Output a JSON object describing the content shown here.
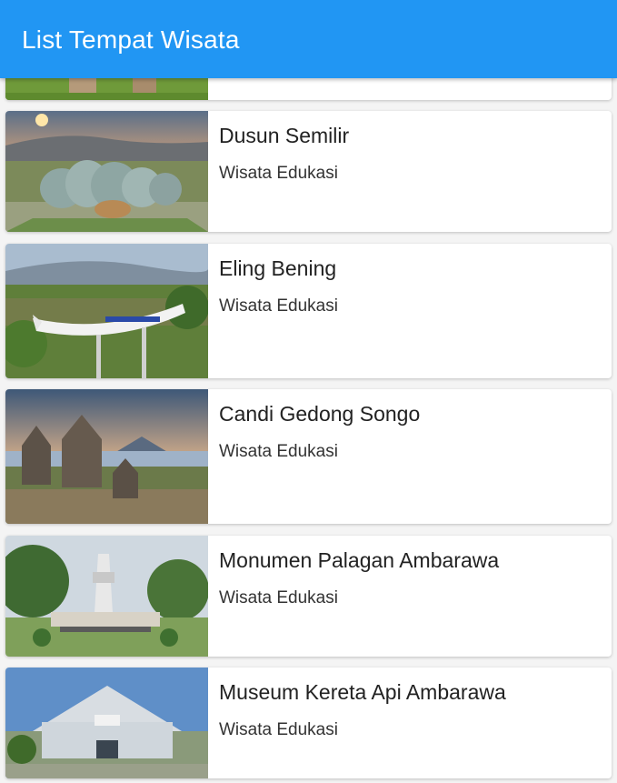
{
  "appbar": {
    "title": "List Tempat Wisata"
  },
  "colors": {
    "primary": "#2196F3",
    "background": "#f4f4f4",
    "card": "#ffffff"
  },
  "places": [
    {
      "name": "",
      "category": ""
    },
    {
      "name": "Dusun Semilir",
      "category": "Wisata Edukasi",
      "image": "dusun-semilir-photo"
    },
    {
      "name": "Eling Bening",
      "category": "Wisata Edukasi",
      "image": "eling-bening-photo"
    },
    {
      "name": "Candi Gedong Songo",
      "category": "Wisata Edukasi",
      "image": "candi-gedong-songo-photo"
    },
    {
      "name": "Monumen Palagan Ambarawa",
      "category": "Wisata Edukasi",
      "image": "monumen-palagan-photo"
    },
    {
      "name": "Museum Kereta Api Ambarawa",
      "category": "Wisata Edukasi",
      "image": "museum-kereta-api-photo"
    }
  ]
}
